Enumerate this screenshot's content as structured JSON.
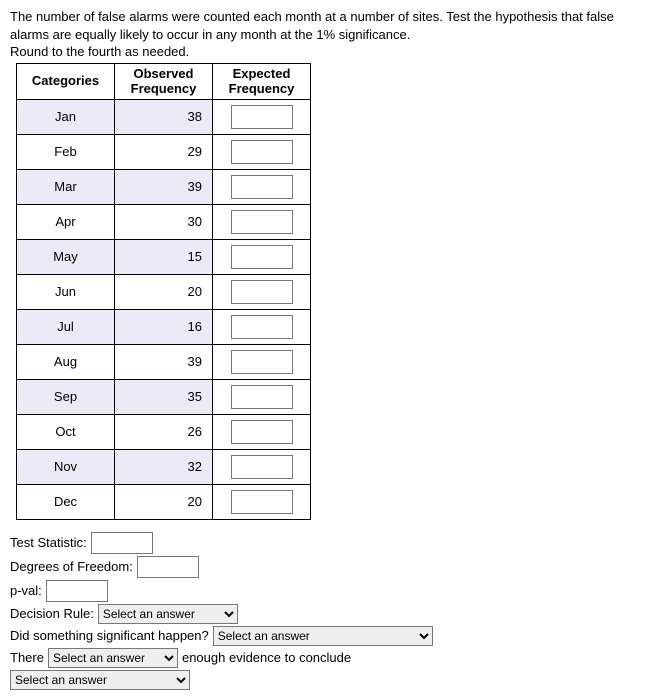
{
  "prompt": {
    "line1": "The number of false alarms were counted each month at a number of sites. Test the hypothesis that false alarms are equally likely to occur in any month at the 1% significance.",
    "line2": "Round to the fourth as needed."
  },
  "table": {
    "headers": {
      "categories": "Categories",
      "observed": "Observed Frequency",
      "expected": "Expected Frequency"
    },
    "rows": [
      {
        "cat": "Jan",
        "obs": "38"
      },
      {
        "cat": "Feb",
        "obs": "29"
      },
      {
        "cat": "Mar",
        "obs": "39"
      },
      {
        "cat": "Apr",
        "obs": "30"
      },
      {
        "cat": "May",
        "obs": "15"
      },
      {
        "cat": "Jun",
        "obs": "20"
      },
      {
        "cat": "Jul",
        "obs": "16"
      },
      {
        "cat": "Aug",
        "obs": "39"
      },
      {
        "cat": "Sep",
        "obs": "35"
      },
      {
        "cat": "Oct",
        "obs": "26"
      },
      {
        "cat": "Nov",
        "obs": "32"
      },
      {
        "cat": "Dec",
        "obs": "20"
      }
    ]
  },
  "questions": {
    "test_stat_label": "Test Statistic:",
    "df_label": "Degrees of Freedom:",
    "pval_label": "p-val:",
    "decision_label": "Decision Rule:",
    "sig_label": "Did something significant happen?",
    "there_label": "There",
    "evidence_suffix": "enough evidence to conclude",
    "select_placeholder": "Select an answer"
  }
}
